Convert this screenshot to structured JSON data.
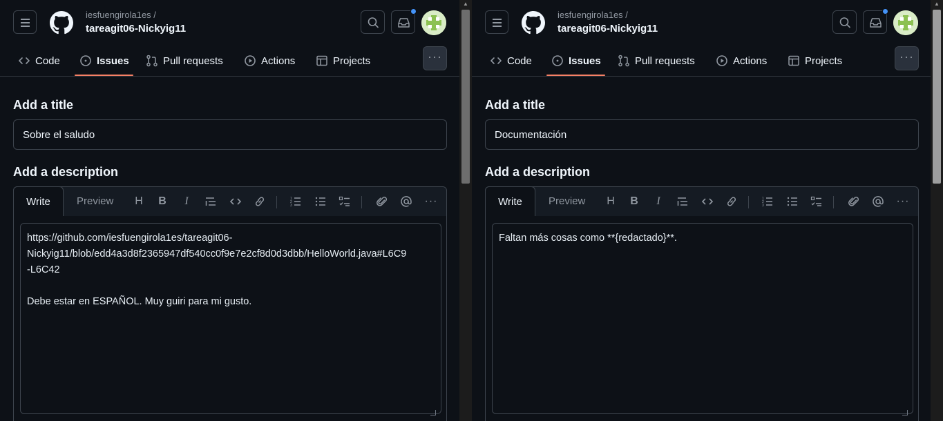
{
  "panes": [
    {
      "owner": "iesfuengirola1es /",
      "repo": "tareagit06-Nickyig11",
      "tabs": {
        "code": "Code",
        "issues": "Issues",
        "pulls": "Pull requests",
        "actions": "Actions",
        "projects": "Projects"
      },
      "title_heading": "Add a title",
      "title_value": "Sobre el saludo",
      "desc_heading": "Add a description",
      "write_label": "Write",
      "preview_label": "Preview",
      "body": "https://github.com/iesfuengirola1es/tareagit06-\nNickyig11/blob/edd4a3d8f2365947df540cc0f9e7e2cf8d0d3dbb/HelloWorld.java#L6C9\n-L6C42\n\nDebe estar en ESPAÑOL. Muy guiri para mi gusto."
    },
    {
      "owner": "iesfuengirola1es /",
      "repo": "tareagit06-Nickyig11",
      "tabs": {
        "code": "Code",
        "issues": "Issues",
        "pulls": "Pull requests",
        "actions": "Actions",
        "projects": "Projects"
      },
      "title_heading": "Add a title",
      "title_value": "Documentación",
      "desc_heading": "Add a description",
      "write_label": "Write",
      "preview_label": "Preview",
      "body": "Faltan más cosas como **{redactado}**."
    }
  ],
  "icons": {
    "menu": "hamburger-icon",
    "logo": "github-logo",
    "search": "search-icon",
    "inbox": "inbox-icon",
    "toolbar": [
      "heading-icon",
      "bold-icon",
      "italic-icon",
      "quote-icon",
      "code-icon",
      "link-icon",
      "ordered-list-icon",
      "unordered-list-icon",
      "task-list-icon",
      "attach-icon",
      "mention-icon",
      "more-icon"
    ]
  },
  "colors": {
    "background": "#0d1117",
    "accent_underline": "#f78166",
    "notification": "#4493f8",
    "border": "#3d444d"
  }
}
